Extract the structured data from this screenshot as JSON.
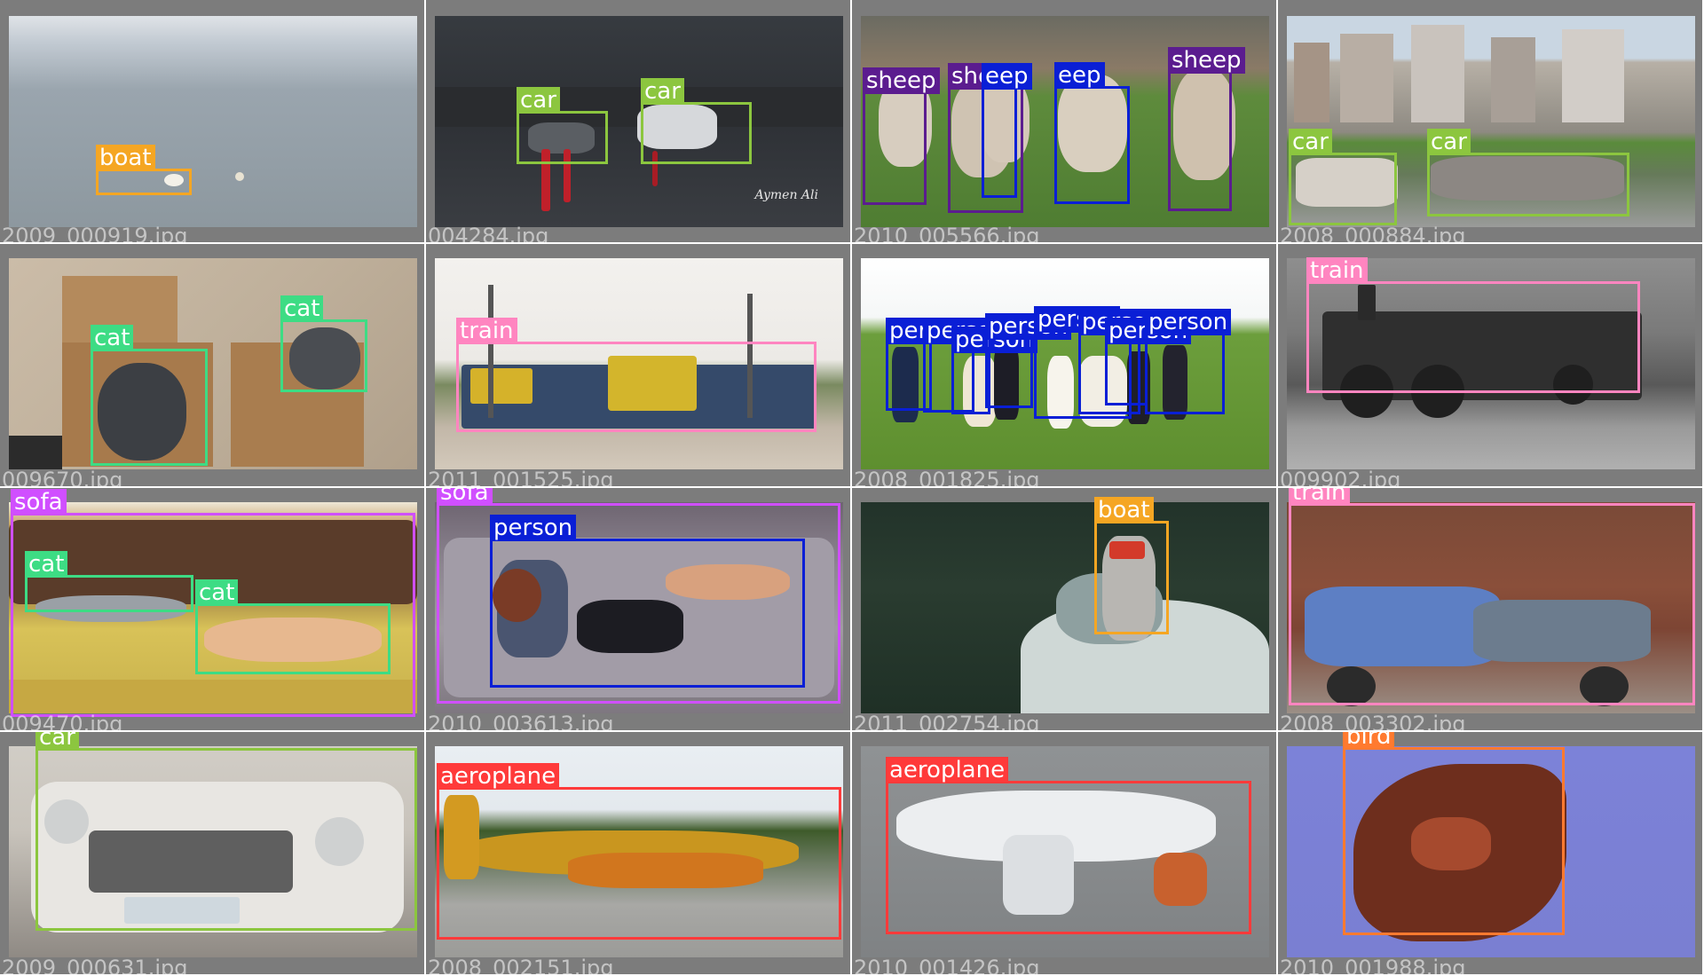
{
  "class_colors": {
    "boat": "#f5a623",
    "car": "#8cc63f",
    "sheep": "#5b1c8f",
    "cat": "#3ddc84",
    "train": "#ff85c0",
    "person": "#0a1fd6",
    "sofa": "#d04fff",
    "aeroplane": "#ff3a3a",
    "bird": "#ff7a2f"
  },
  "tiles": [
    {
      "filename": "2009_000919.jpg",
      "scene": "calm-sea",
      "detections": [
        {
          "label": "boat"
        }
      ]
    },
    {
      "filename": "004284.jpg",
      "scene": "night-road-cars",
      "watermark": "Aymen Ali",
      "detections": [
        {
          "label": "car"
        },
        {
          "label": "car"
        }
      ]
    },
    {
      "filename": "2010_005566.jpg",
      "scene": "sheep-field",
      "detections": [
        {
          "label": "sheep"
        },
        {
          "label": "sheep"
        },
        {
          "label": "eep"
        },
        {
          "label": "eep"
        },
        {
          "label": "sheep"
        }
      ]
    },
    {
      "filename": "2008_000884.jpg",
      "scene": "city-parked-cars",
      "detections": [
        {
          "label": "car"
        },
        {
          "label": "car"
        }
      ]
    },
    {
      "filename": "009670.jpg",
      "scene": "cats-in-boxes",
      "detections": [
        {
          "label": "cat"
        },
        {
          "label": "cat"
        }
      ]
    },
    {
      "filename": "2011_001525.jpg",
      "scene": "freight-locomotive",
      "detections": [
        {
          "label": "train"
        }
      ]
    },
    {
      "filename": "2008_001825.jpg",
      "scene": "wedding-group-lawn",
      "detections": [
        {
          "label": "person"
        },
        {
          "label": "person"
        },
        {
          "label": "person"
        },
        {
          "label": "person"
        },
        {
          "label": "person"
        },
        {
          "label": "person"
        },
        {
          "label": "person"
        },
        {
          "label": "person"
        }
      ]
    },
    {
      "filename": "009902.jpg",
      "scene": "steam-locomotive-bw",
      "detections": [
        {
          "label": "train"
        }
      ]
    },
    {
      "filename": "009470.jpg",
      "scene": "cats-on-couch",
      "detections": [
        {
          "label": "sofa"
        },
        {
          "label": "cat"
        },
        {
          "label": "cat"
        }
      ]
    },
    {
      "filename": "2010_003613.jpg",
      "scene": "woman-on-sofa",
      "detections": [
        {
          "label": "sofa"
        },
        {
          "label": "person"
        }
      ]
    },
    {
      "filename": "2011_002754.jpg",
      "scene": "boat-wake",
      "detections": [
        {
          "label": "boat"
        }
      ]
    },
    {
      "filename": "2008_003302.jpg",
      "scene": "graffiti-boxcar",
      "detections": [
        {
          "label": "train"
        }
      ]
    },
    {
      "filename": "2009_000631.jpg",
      "scene": "vintage-car",
      "detections": [
        {
          "label": "car"
        }
      ]
    },
    {
      "filename": "2008_002151.jpg",
      "scene": "small-plane-airfield",
      "detections": [
        {
          "label": "aeroplane"
        }
      ]
    },
    {
      "filename": "2010_001426.jpg",
      "scene": "airliner-sky",
      "detections": [
        {
          "label": "aeroplane"
        }
      ]
    },
    {
      "filename": "2010_001988.jpg",
      "scene": "vulture-sky",
      "detections": [
        {
          "label": "bird"
        }
      ]
    }
  ]
}
